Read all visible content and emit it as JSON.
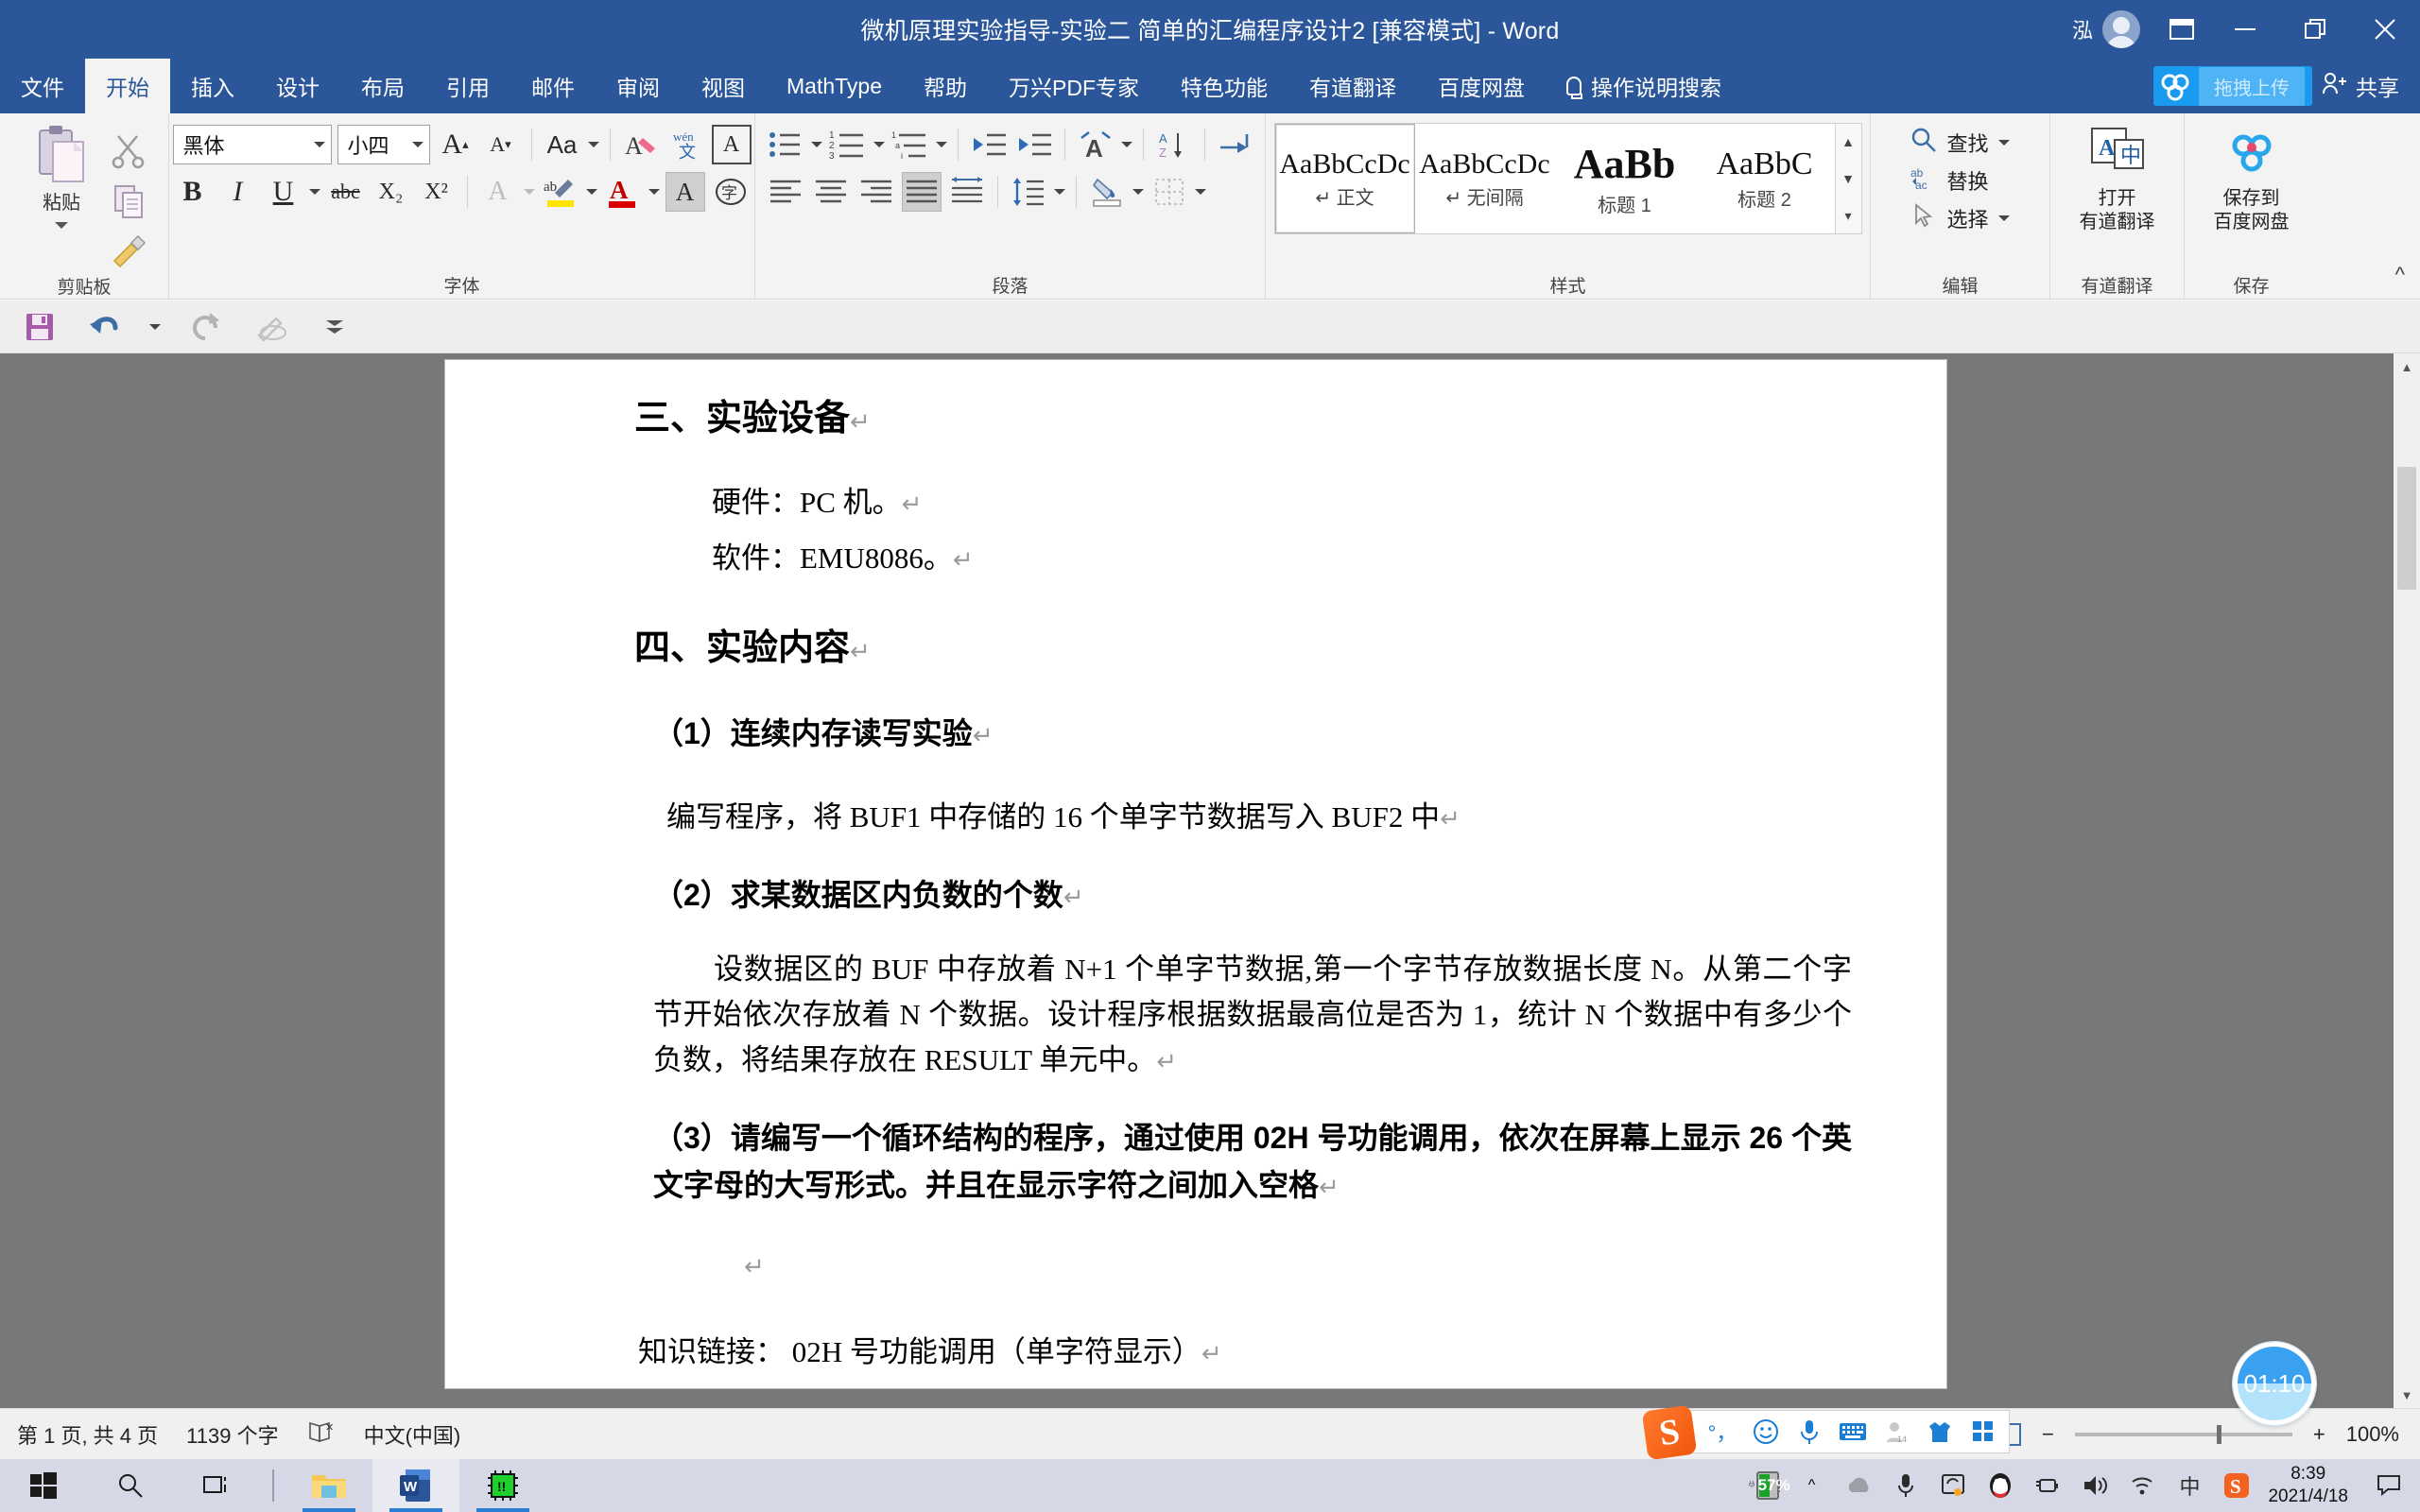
{
  "window": {
    "title": "微机原理实验指导-实验二 简单的汇编程序设计2 [兼容模式]  -  Word",
    "account_name": "泓",
    "minimize": "—",
    "restore": "❐",
    "close": "✕",
    "ribbon_display_options": "▭"
  },
  "tabs": [
    {
      "label": "文件",
      "active": false
    },
    {
      "label": "开始",
      "active": true
    },
    {
      "label": "插入",
      "active": false
    },
    {
      "label": "设计",
      "active": false
    },
    {
      "label": "布局",
      "active": false
    },
    {
      "label": "引用",
      "active": false
    },
    {
      "label": "邮件",
      "active": false
    },
    {
      "label": "审阅",
      "active": false
    },
    {
      "label": "视图",
      "active": false
    },
    {
      "label": "MathType",
      "active": false
    },
    {
      "label": "帮助",
      "active": false
    },
    {
      "label": "万兴PDF专家",
      "active": false
    },
    {
      "label": "特色功能",
      "active": false
    },
    {
      "label": "有道翻译",
      "active": false
    },
    {
      "label": "百度网盘",
      "active": false
    }
  ],
  "tell_me": "操作说明搜索",
  "upload_chip": "拖拽上传",
  "share": "共享",
  "ribbon": {
    "clipboard": {
      "group_label": "剪贴板",
      "paste_label": "粘贴",
      "cut": "剪切",
      "copy": "复制",
      "format_painter": "格式刷"
    },
    "font": {
      "group_label": "字体",
      "font_name": "黑体",
      "font_size": "小四",
      "grow": "A",
      "shrink": "A",
      "change_case": "Aa",
      "clear_format": "A",
      "phonetic": "wén",
      "char_border": "A",
      "bold": "B",
      "italic": "I",
      "underline": "U",
      "strikethrough": "abc",
      "subscript": "X₂",
      "superscript": "X²",
      "text_effects": "A",
      "highlight": "ab",
      "font_color": "A",
      "shading": "A",
      "enclose_char": "字"
    },
    "paragraph": {
      "group_label": "段落"
    },
    "styles": {
      "group_label": "样式",
      "items": [
        {
          "preview": "AaBbCcDc",
          "name": "正文",
          "mark": "↵",
          "selected": true,
          "kind": "normal"
        },
        {
          "preview": "AaBbCcDc",
          "name": "无间隔",
          "mark": "↵",
          "selected": false,
          "kind": "normal"
        },
        {
          "preview": "AaBb",
          "name": "标题 1",
          "mark": "",
          "selected": false,
          "kind": "h1"
        },
        {
          "preview": "AaBbC",
          "name": "标题 2",
          "mark": "",
          "selected": false,
          "kind": "h2"
        }
      ]
    },
    "editing": {
      "group_label": "编辑",
      "find": "查找",
      "replace": "替换",
      "select": "选择"
    },
    "youdao": {
      "group_label": "有道翻译",
      "button_line1": "打开",
      "button_line2": "有道翻译"
    },
    "baidu": {
      "group_label": "保存",
      "button_line1": "保存到",
      "button_line2": "百度网盘"
    },
    "collapse": "^"
  },
  "quick_access": {
    "save": "save-icon",
    "undo": "undo-icon",
    "redo": "redo-icon",
    "pen": "pen-icon",
    "more": "more-icon"
  },
  "document": {
    "blocks": [
      {
        "type": "heading",
        "text": "三、实验设备",
        "mark": "↵"
      },
      {
        "type": "body-indent",
        "text": "硬件：PC 机。",
        "mark": "↵"
      },
      {
        "type": "body-indent",
        "text": "软件：EMU8086。",
        "mark": "↵"
      },
      {
        "type": "heading",
        "text": "四、实验内容",
        "mark": "↵"
      },
      {
        "type": "bold",
        "text": "（1）连续内存读写实验",
        "mark": "↵"
      },
      {
        "type": "body",
        "text": "编写程序，将 BUF1 中存储的 16 个单字节数据写入 BUF2 中",
        "mark": "↵"
      },
      {
        "type": "bold",
        "text": "（2）求某数据区内负数的个数",
        "mark": "↵"
      },
      {
        "type": "body",
        "text": "设数据区的 BUF 中存放着 N+1 个单字节数据,第一个字节存放数据长度 N。从第二个字节开始依次存放着 N 个数据。设计程序根据数据最高位是否为 1，统计 N 个数据中有多少个负数，将结果存放在 RESULT 单元中。",
        "mark": "↵"
      },
      {
        "type": "bold",
        "text": "（3）请编写一个循环结构的程序，通过使用 02H 号功能调用，依次在屏幕上显示 26 个英文字母的大写形式。并且在显示字符之间加入空格",
        "mark": "↵"
      },
      {
        "type": "empty",
        "text": "",
        "mark": "↵"
      },
      {
        "type": "body",
        "text": "知识链接：   02H 号功能调用（单字符显示）",
        "mark": "↵"
      }
    ]
  },
  "status_bar": {
    "page_info": "第 1 页, 共 4 页",
    "word_count": "1139 个字",
    "proofing_icon": "proofing-errors-icon",
    "language": "中文(中国)",
    "zoom_out": "−",
    "zoom_in": "+",
    "zoom_level": "100%"
  },
  "ime_toolbar": {
    "logo": "S",
    "mode": "中",
    "punctuation": "°，",
    "emoji": "☺",
    "voice": "voice-icon",
    "keyboard": "keyboard-icon",
    "user": "user-icon",
    "skin": "skin-icon",
    "apps": "apps-icon"
  },
  "timer_widget": {
    "value": "01:10"
  },
  "taskbar": {
    "start": "start-icon",
    "search": "search-icon",
    "task_view": "task-view-icon",
    "apps": [
      {
        "name": "file-explorer",
        "active": false,
        "running": true
      },
      {
        "name": "word",
        "active": true,
        "running": true
      },
      {
        "name": "emu8086",
        "active": false,
        "running": true
      }
    ],
    "tray": {
      "battery_percent": "57%",
      "chevron": "^",
      "onedrive": "onedrive-icon",
      "mic": "mic-icon",
      "screen": "screen-capture-icon",
      "qq": "qq-icon",
      "power": "power-icon",
      "volume": "volume-icon",
      "wifi": "wifi-icon",
      "ime": "中",
      "sogou": "S",
      "time": "8:39",
      "date": "2021/4/18",
      "notifications": "notification-icon"
    }
  },
  "colors": {
    "word_blue": "#2b579a",
    "ribbon_bg": "#f3f3f3",
    "doc_bg": "#787878",
    "accent_blue": "#1a9bf0",
    "battery_green": "#19a22c",
    "taskbar": "#d7d8e6"
  }
}
